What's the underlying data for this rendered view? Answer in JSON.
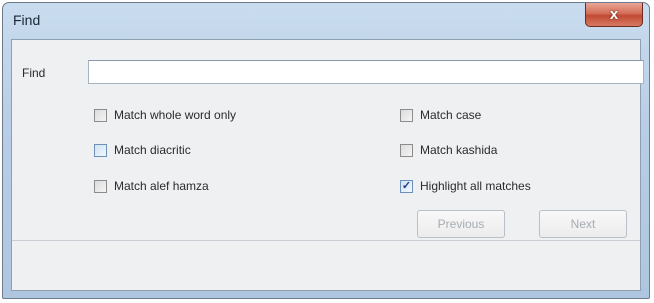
{
  "window": {
    "title": "Find"
  },
  "find": {
    "label": "Find",
    "value": ""
  },
  "options": {
    "match_whole_word": {
      "label": "Match whole word only",
      "checked": false
    },
    "match_diacritic": {
      "label": "Match diacritic",
      "checked": false
    },
    "match_alef_hamza": {
      "label": "Match alef hamza",
      "checked": false
    },
    "match_case": {
      "label": "Match case",
      "checked": false
    },
    "match_kashida": {
      "label": "Match kashida",
      "checked": false
    },
    "highlight_all": {
      "label": "Highlight all matches",
      "checked": true
    }
  },
  "buttons": {
    "previous": "Previous",
    "next": "Next",
    "close": "x"
  },
  "icons": {
    "close": "close-icon",
    "check": "check-icon"
  }
}
